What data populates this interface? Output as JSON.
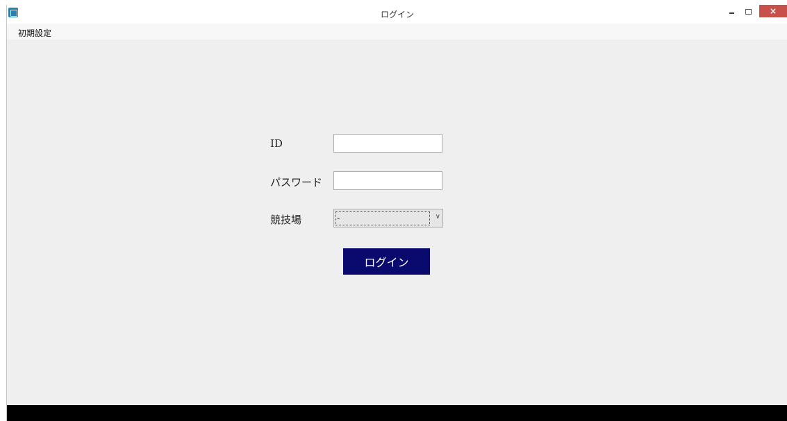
{
  "window": {
    "title": "ログイン",
    "close_glyph": "×"
  },
  "menu": {
    "items": [
      "初期設定"
    ]
  },
  "form": {
    "id_label": "ID",
    "id_value": "",
    "password_label": "パスワード",
    "password_value": "",
    "venue_label": "競技場",
    "venue_selected": "-",
    "login_button": "ログイン"
  },
  "icons": {
    "app": "app-icon",
    "dropdown": "chevron-down-icon"
  },
  "colors": {
    "login_button_bg": "#0a0a6e",
    "close_button_bg": "#c7504b",
    "background": "#efefef",
    "bottom_bar": "#000000"
  }
}
